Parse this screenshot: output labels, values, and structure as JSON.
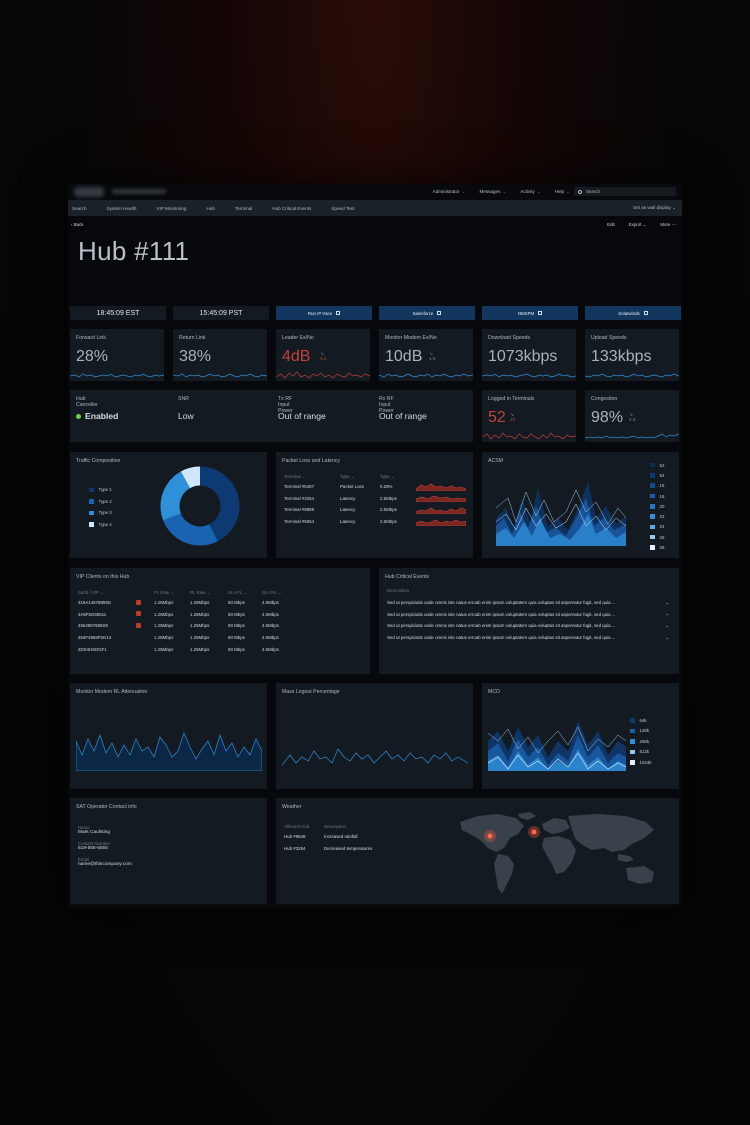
{
  "nav": {
    "top_items": [
      {
        "label": "Administrator"
      },
      {
        "label": "Messages"
      },
      {
        "label": "Activity"
      },
      {
        "label": "Help"
      }
    ],
    "search_placeholder": "Search",
    "sub_items": [
      "Search",
      "System Health",
      "VIP Monitoring",
      "Hub",
      "Terminal",
      "Hub Critical Events",
      "Speed Test"
    ],
    "wall_display": "Set as wall display"
  },
  "actions": {
    "back": "Back",
    "edit": "Edit",
    "export": "Export",
    "more": "More"
  },
  "page_title": "Hub #111",
  "clocks": [
    "18:45:09 EST",
    "15:45:09 PST"
  ],
  "links": [
    "Run IP trace",
    "Salesforce",
    "NMSPM",
    "Solarwinds"
  ],
  "metrics": [
    {
      "label": "Forward Link",
      "value": "28%"
    },
    {
      "label": "Return Link",
      "value": "38%"
    },
    {
      "label": "Leader Es/No",
      "value": "4dB",
      "trend": "3.4",
      "alert": true
    },
    {
      "label": "Monitor Modem Es/No",
      "value": "10dB",
      "trend": "1.5"
    },
    {
      "label": "Download Speeds",
      "value": "1073kbps"
    },
    {
      "label": "Upload Speeds",
      "value": "133kbps"
    }
  ],
  "status": [
    {
      "label": "Hub Canceller",
      "value": "Enabled"
    },
    {
      "label": "SNR",
      "value": "Low"
    },
    {
      "label": "Tx RF Input Power",
      "value": "Out of range"
    },
    {
      "label": "Rx RF Input Power",
      "value": "Out of range"
    }
  ],
  "terminals": {
    "label": "Logged in Terminals",
    "value": "52",
    "trend": "10"
  },
  "congestion": {
    "label": "Congestion",
    "value": "98%",
    "trend": "2.3"
  },
  "traffic": {
    "title": "Traffic Composition",
    "legend": [
      "Type 1",
      "Type 2",
      "Type 3",
      "Type 4"
    ],
    "colors": [
      "#0d3a73",
      "#1a63b0",
      "#2f8fd8",
      "#cfe6fb"
    ]
  },
  "packet": {
    "title": "Packet Loss and Latency",
    "headers": [
      "Terminal",
      "Type",
      "Type"
    ],
    "rows": [
      [
        "Terminal #6497",
        "Packet Loss",
        "0.28%"
      ],
      [
        "Terminal #3264",
        "Latency",
        "2.5Mbps"
      ],
      [
        "Terminal #9899",
        "Latency",
        "2.5Mbps"
      ],
      [
        "Terminal #5554",
        "Latency",
        "2.5Mbps"
      ]
    ]
  },
  "acsm": {
    "title": "ACSM",
    "legend": [
      "52",
      "54",
      "16",
      "18",
      "20",
      "22",
      "24",
      "26",
      "28"
    ]
  },
  "vip": {
    "title": "VIP Clients on this Hub",
    "headers": [
      "SatId / VIP",
      "FL Rate",
      "RL Rate",
      "SLA FL",
      "SLA RL"
    ],
    "rows": [
      [
        "316A14678859G",
        "1.25Mbps",
        "1.25Mbps",
        "60 Mbps",
        "4.5Mbps"
      ],
      [
        "3A5F5G65611",
        "1.25Mbps",
        "1.25Mbps",
        "60 Mbps",
        "4.5Mbps"
      ],
      [
        "4564657685S9",
        "1.25Mbps",
        "1.25Mbps",
        "60 Mbps",
        "4.5Mbps"
      ],
      [
        "353F4968F5G14",
        "1.25Mbps",
        "1.25Mbps",
        "60 Mbps",
        "4.5Mbps"
      ],
      [
        "2DS4HSDGF1",
        "1.25Mbps",
        "1.25Mbps",
        "60 Mbps",
        "4.5Mbps"
      ]
    ]
  },
  "critical": {
    "title": "Hub Critical Events",
    "header": "Description",
    "rows": [
      "Sed ut perspiciatis unde omnis iste natus erroab enim ipsam voluptatem quia voluptas sit aspernatur fugit, sed quia ...",
      "Sed ut perspiciatis unde omnis iste natus erroab enim ipsam voluptatem quia voluptas sit aspernatur fugit, sed quia ...",
      "Sed ut perspiciatis unde omnis iste natus erroab enim ipsam voluptatem quia voluptas sit aspernatur fugit, sed quia ...",
      "Sed ut perspiciatis unde omnis iste natus erroab enim ipsam voluptatem quia voluptas sit aspernatur fugit, sed quia ..."
    ]
  },
  "attenuation": {
    "title": "Monitor Modem RL Attenuation"
  },
  "logout": {
    "title": "Mass Logout Percentage"
  },
  "mcd": {
    "title": "MCD",
    "legend": [
      "64k",
      "128k",
      "256k",
      "512k",
      "1024k"
    ]
  },
  "contact": {
    "title": "SAT Operator Contact info",
    "name_label": "Name",
    "name": "Mark Caulsting",
    "phone_label": "Contact Number",
    "phone": "619-555-5555",
    "email_label": "Email",
    "email": "name@thiscompany.com"
  },
  "weather": {
    "title": "Weather",
    "headers": [
      "Affected Hub",
      "Description"
    ],
    "rows": [
      [
        "Hub #9846",
        "Increased rainfall"
      ],
      [
        "Hub #3264",
        "Decreased temperatures"
      ]
    ]
  },
  "colors": {
    "accent_blue": "#13365f",
    "alert_red": "#c0423a",
    "ok_green": "#6fcf3c",
    "line_blue": "#2f8fd8"
  }
}
